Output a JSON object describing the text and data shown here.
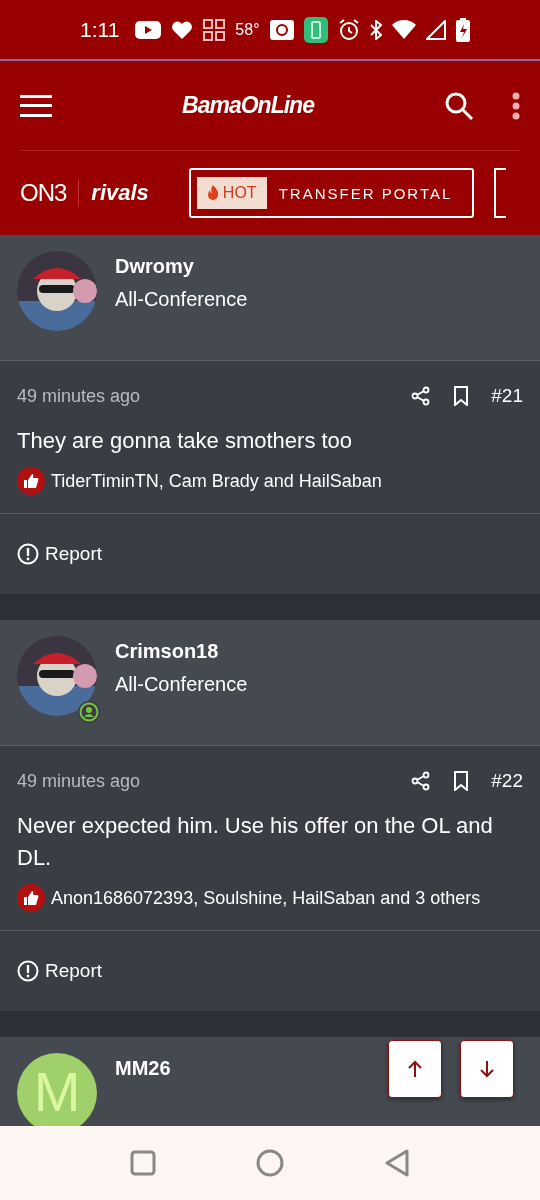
{
  "status_bar": {
    "time": "1:11",
    "temperature": "58°"
  },
  "header": {
    "logo": "BamaOnLine",
    "brand_left": "ON3",
    "brand_right": "rivals",
    "hot_badge": "HOT",
    "promo": "TRANSFER PORTAL"
  },
  "posts": [
    {
      "kind": "full",
      "username": "Dwromy",
      "rank": "All-Conference",
      "online": false,
      "time": "49 minutes ago",
      "number": "#21",
      "text": "They are gonna take smothers too",
      "likes": "TiderTiminTN, Cam Brady and HailSaban",
      "report": "Report"
    },
    {
      "kind": "full",
      "username": "Crimson18",
      "rank": "All-Conference",
      "online": true,
      "time": "49 minutes ago",
      "number": "#22",
      "text": "Never expected him. Use his offer on the OL and DL.",
      "likes": "Anon1686072393, Soulshine, HailSaban and 3 others",
      "report": "Report"
    },
    {
      "kind": "partial",
      "username": "MM26",
      "avatar": {
        "kind": "initial",
        "initial": "M",
        "color": "#9fd06a"
      },
      "online": false
    }
  ]
}
